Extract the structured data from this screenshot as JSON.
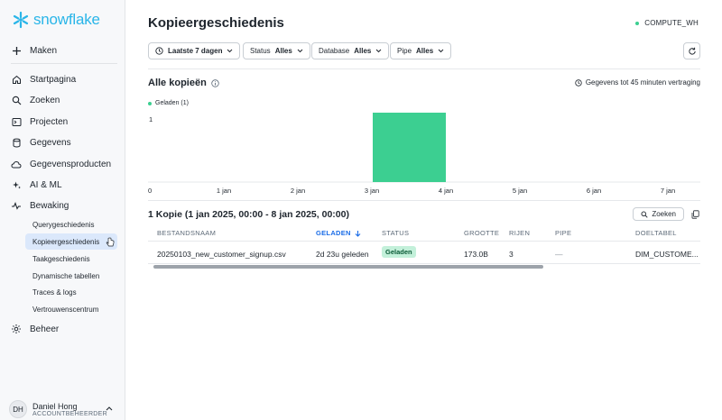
{
  "app": {
    "logo_text": "snowflake"
  },
  "sidebar": {
    "create_label": "Maken",
    "items": [
      {
        "label": "Startpagina"
      },
      {
        "label": "Zoeken"
      },
      {
        "label": "Projecten"
      },
      {
        "label": "Gegevens"
      },
      {
        "label": "Gegevensproducten"
      },
      {
        "label": "AI & ML"
      },
      {
        "label": "Bewaking"
      }
    ],
    "sub_items": [
      {
        "label": "Querygeschiedenis"
      },
      {
        "label": "Kopieergeschiedenis"
      },
      {
        "label": "Taakgeschiedenis"
      },
      {
        "label": "Dynamische tabellen"
      },
      {
        "label": "Traces & logs"
      },
      {
        "label": "Vertrouwenscentrum"
      }
    ],
    "admin_label": "Beheer",
    "user": {
      "initials": "DH",
      "name": "Daniel Hong",
      "role": "ACCOUNTBEHEERDER"
    }
  },
  "header": {
    "title": "Kopieergeschiedenis",
    "warehouse": "COMPUTE_WH"
  },
  "filters": {
    "time": "Laatste 7 dagen",
    "status_label": "Status",
    "status_value": "Alles",
    "database_label": "Database",
    "database_value": "Alles",
    "pipe_label": "Pipe",
    "pipe_value": "Alles"
  },
  "chart_section": {
    "title": "Alle kopieën",
    "delay_note": "Gegevens tot 45 minuten vertraging"
  },
  "chart_data": {
    "type": "bar",
    "categories": [
      "0",
      "1 jan",
      "2 jan",
      "3 jan",
      "4 jan",
      "5 jan",
      "6 jan",
      "7 jan"
    ],
    "series": [
      {
        "name": "Geladen (1)",
        "color": "#3ccf91",
        "values": [
          0,
          0,
          0,
          1,
          0,
          0,
          0
        ]
      }
    ],
    "y_tick": "1",
    "ylim": [
      0,
      1
    ],
    "legend": "top-left"
  },
  "table": {
    "title": "1 Kopie (1 jan 2025, 00:00 - 8 jan 2025, 00:00)",
    "search_label": "Zoeken",
    "columns": [
      "BESTANDSNAAM",
      "GELADEN",
      "STATUS",
      "GROOTTE",
      "RIJEN",
      "PIPE",
      "DOELTABEL"
    ],
    "rows": [
      {
        "file": "20250103_new_customer_signup.csv",
        "loaded": "2d 23u geleden",
        "status": "Geladen",
        "size": "173.0B",
        "rows": "3",
        "pipe": "—",
        "target": "DIM_CUSTOME..."
      }
    ]
  }
}
